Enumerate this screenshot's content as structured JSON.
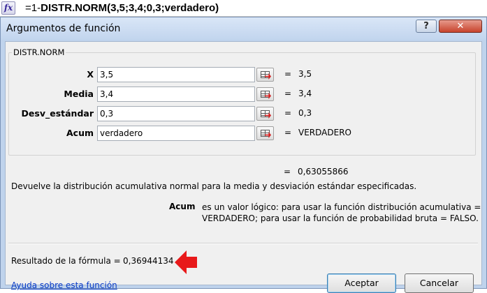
{
  "formula_bar": {
    "fx_label": "fx",
    "formula_prefix": "=1-",
    "formula_main": "DISTR.NORM(3,5;3,4;0,3;verdadero)"
  },
  "dialog": {
    "title": "Argumentos de función",
    "help_label": "?",
    "close_label": "✕",
    "function_name": "DISTR.NORM",
    "args": [
      {
        "label": "X",
        "value": "3,5",
        "result": "3,5"
      },
      {
        "label": "Media",
        "value": "3,4",
        "result": "3,4"
      },
      {
        "label": "Desv_estándar",
        "value": "0,3",
        "result": "0,3"
      },
      {
        "label": "Acum",
        "value": "verdadero",
        "result": "VERDADERO"
      }
    ],
    "equals": "=",
    "total_result": "0,63055866",
    "description": "Devuelve la distribución acumulativa normal para la media y desviación estándar especificadas.",
    "arg_help_name": "Acum",
    "arg_help_text": "es un valor lógico: para usar la función distribución acumulativa = VERDADERO; para usar la función de probabilidad bruta = FALSO.",
    "result_label": "Resultado de la fórmula =",
    "result_value": "0,36944134",
    "help_link": "Ayuda sobre esta función",
    "ok_label": "Aceptar",
    "cancel_label": "Cancelar"
  },
  "colors": {
    "dialog_frame": "#bfd3ec",
    "arrow": "#e8191a",
    "link": "#0a3cc8"
  }
}
